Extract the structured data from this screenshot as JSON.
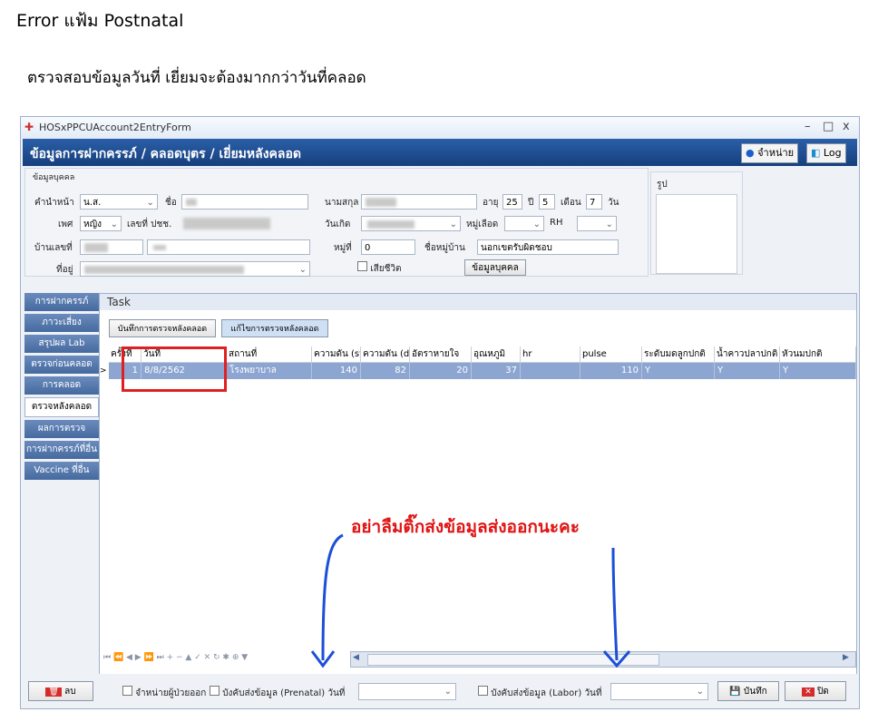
{
  "doc": {
    "title": "Error แฟ้ม Postnatal",
    "subtitle": "ตรวจสอบข้อมูลวันที่ เยี่ยมจะต้องมากกว่าวันที่คลอด"
  },
  "window": {
    "title": "HOSxPPCUAccount2EntryForm",
    "controls": {
      "min": "–",
      "max": "□",
      "close": "x"
    },
    "header_title": "ข้อมูลการฝากครรภ์ / คลอดบุตร / เยี่ยมหลังคลอด",
    "btn_discharge": "จำหน่าย",
    "btn_log": "Log"
  },
  "person": {
    "section": "ข้อมูลบุคคล",
    "prefix_label": "คำนำหน้า",
    "prefix": "น.ส.",
    "name_label": "ชื่อ",
    "surname_label": "นามสกุล",
    "age_label": "อายุ",
    "age_years": "25",
    "years": "ปี",
    "age_months": "5",
    "months": "เดือน",
    "age_days": "7",
    "days": "วัน",
    "sex_label": "เพศ",
    "sex": "หญิง",
    "cid_label": "เลขที่ ปชช.",
    "dob_label": "วันเกิด",
    "blood_label": "หมู่เลือด",
    "rh_label": "RH",
    "house_label": "บ้านเลขที่",
    "moo_label": "หมู่ที่",
    "moo": "0",
    "village_label": "ชื่อหมู่บ้าน",
    "village": "นอกเขตรับผิดชอบ",
    "address_label": "ที่อยู่",
    "dead_label": "เสียชีวิต",
    "person_btn": "ข้อมูลบุคคล",
    "photo_label": "รูป"
  },
  "tabs": [
    "การฝากครรภ์",
    "ภาวะเสี่ยง",
    "สรุปผล Lab",
    "ตรวจก่อนคลอด",
    "การคลอด",
    "ตรวจหลังคลอด",
    "ผลการตรวจ",
    "การฝากครรภ์ที่อื่น",
    "Vaccine ที่อื่น"
  ],
  "task": {
    "title": "Task",
    "btn_record": "บันทึกการตรวจหลังคลอด",
    "btn_edit": "แก้ไขการตรวจหลังคลอด"
  },
  "grid": {
    "headers": [
      "ครั้งที่",
      "วันที่",
      "สถานที่",
      "ความดัน (sys",
      "ความดัน (dia",
      "อัตราหายใจ",
      "อุณหภูมิ",
      "hr",
      "pulse",
      "ระดับมดลูกปกติ",
      "น้ำคาวปลาปกติ",
      "หัวนมปกติ"
    ],
    "row": [
      "1",
      "8/8/2562",
      "โรงพยาบาล",
      "140",
      "82",
      "20",
      "37",
      "",
      "110",
      "Y",
      "Y",
      "Y"
    ],
    "nav_icons": "⏮ ⏪ ◀ ▶ ⏩ ⏭ + − ▲ ✓ ✕ ↻ ✱ ⊕ ▼"
  },
  "annotation": "อย่าลืมติ๊กส่งข้อมูลส่งออกนะคะ",
  "footer": {
    "delete": "ลบ",
    "discharge_chk": "จำหน่ายผู้ป่วยออก",
    "prenatal_chk": "บังคับส่งข้อมูล (Prenatal) วันที่",
    "labor_chk": "บังคับส่งข้อมูล (Labor) วันที่",
    "save": "บันทึก",
    "close": "ปิด"
  }
}
